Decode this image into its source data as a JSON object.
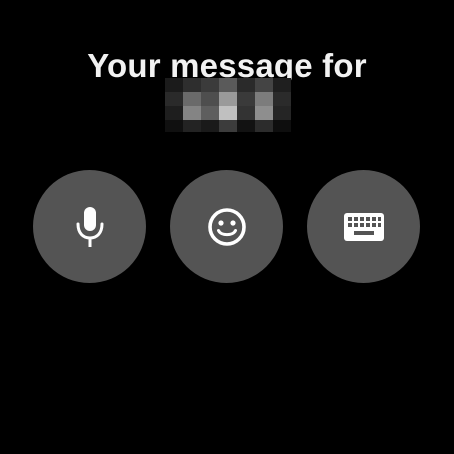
{
  "screen": {
    "title": "Your message for",
    "recipient_name_pixelated": true
  },
  "actions": [
    {
      "id": "voice",
      "icon": "microphone-icon",
      "label": "Voice input"
    },
    {
      "id": "emoji",
      "icon": "smiley-face-icon",
      "label": "Emoji"
    },
    {
      "id": "keyboard",
      "icon": "keyboard-icon",
      "label": "Keyboard"
    }
  ],
  "colors": {
    "background": "#000000",
    "button": "#545454",
    "icon": "#ffffff",
    "title": "#f2f2f2"
  }
}
